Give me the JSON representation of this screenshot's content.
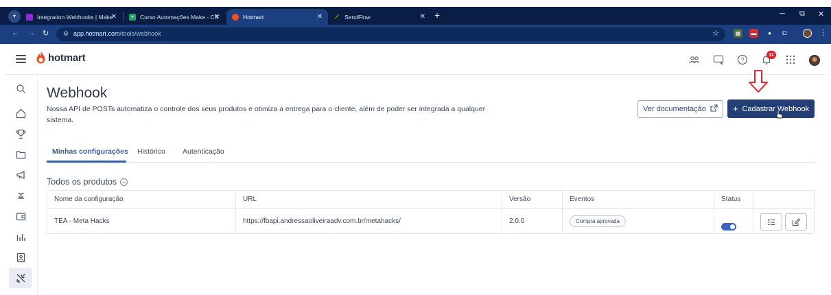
{
  "browser": {
    "tabs": [
      {
        "title": "Integration Webhooks | Make",
        "favicon_color": "#8e2bd6"
      },
      {
        "title": "Curso Automações Make - CST",
        "favicon_color": "#1fa463"
      },
      {
        "title": "Hotmart",
        "favicon_color": "#f04e23"
      },
      {
        "title": "SendFlow",
        "favicon_color": "#b7e000"
      }
    ],
    "active_tab": 2,
    "new_tab": "+",
    "address": {
      "host": "app.hotmart.com",
      "path": "/tools/webhook"
    }
  },
  "header": {
    "brand": "hotmart",
    "notification_count": "11",
    "icons": [
      "users-icon",
      "chat-icon",
      "help-icon",
      "bell-icon",
      "apps-grid-icon",
      "avatar"
    ]
  },
  "sidebar": {
    "items": [
      "search-icon",
      "home-icon",
      "trophy-icon",
      "folder-icon",
      "megaphone-icon",
      "money-icon",
      "wallet-icon",
      "chart-icon",
      "person-badge-icon",
      "tools-icon"
    ],
    "active_index": 9
  },
  "page": {
    "title": "Webhook",
    "description": "Nossa API de POSTs automatiza o controle dos seus produtos e otimiza a entrega para o cliente, além de poder ser integrada a qualquer sistema.",
    "btn_docs": "Ver documentação",
    "btn_add": "Cadastrar Webhook",
    "tabs": [
      "Minhas configurações",
      "Histórico",
      "Autenticação"
    ],
    "section_title": "Todos os produtos"
  },
  "table": {
    "columns": [
      "Nome da configuração",
      "URL",
      "Versão",
      "Eventos",
      "Status",
      ""
    ],
    "rows": [
      {
        "name": "TEA - Meta Hacks",
        "url": "https://fbapi.andressaoliveiraadv.com.br/metahacks/",
        "version": "2.0.0",
        "event": "Compra aprovada",
        "status_on": true
      }
    ]
  },
  "colors": {
    "brand": "#f04e23",
    "primary": "#243f76",
    "accent": "#3a5aa0",
    "alert": "#e8232b"
  }
}
